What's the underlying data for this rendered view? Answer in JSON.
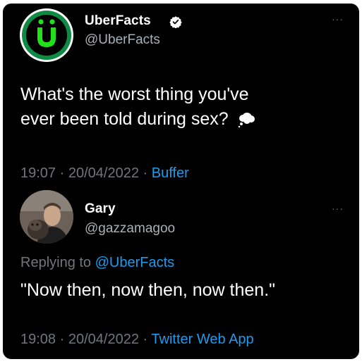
{
  "tweet": {
    "author_name": "UberFacts",
    "author_handle": "@UberFacts",
    "avatar_letter": "Ü",
    "text_line1": "What's the worst thing you've",
    "text_line2": "ever been told during sex?",
    "emoji_icon": "thought-balloon-icon",
    "time": "19:07",
    "date": "20/04/2022",
    "separator": "·",
    "source": "Buffer",
    "more_label": "···"
  },
  "reply": {
    "author_name": "Gary",
    "author_handle": "@gazzamagoo",
    "replying_label": "Replying to",
    "replying_mention": "@UberFacts",
    "text": "\"Now then, now then, now then.\"",
    "time": "19:08",
    "date": "20/04/2022",
    "separator": "·",
    "source": "Twitter Web App",
    "more_label": "···"
  },
  "colors": {
    "background": "#000000",
    "text": "#ffffff",
    "secondary": "#71767b",
    "link": "#1d9bf0",
    "brand_green": "#0e8a45",
    "brand_lime": "#22e11a"
  }
}
